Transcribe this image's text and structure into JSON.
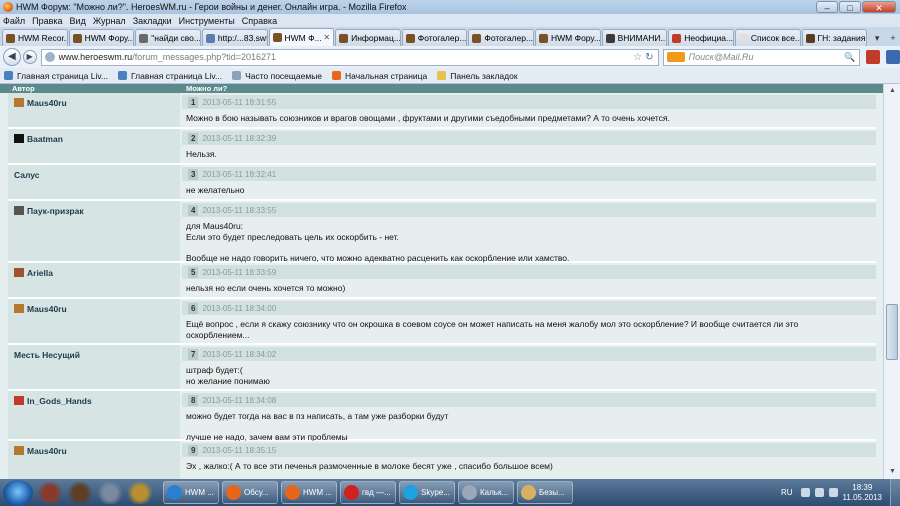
{
  "window": {
    "title": "HWM Форум: \"Можно ли?\". HeroesWM.ru - Герои войны и денег. Онлайн игра. - Mozilla Firefox",
    "minimize": "–",
    "maximize": "□",
    "close": "✕"
  },
  "menu": [
    "Файл",
    "Правка",
    "Вид",
    "Журнал",
    "Закладки",
    "Инструменты",
    "Справка"
  ],
  "tabs": [
    {
      "label": "HWM Recor...",
      "color": "#7a5226"
    },
    {
      "label": "HWM Фору...",
      "color": "#7a5226"
    },
    {
      "label": "\"найди сво...",
      "color": "#6a6a6a"
    },
    {
      "label": "http:/...83.swf",
      "color": "#5b7fb0"
    },
    {
      "label": "HWM Ф...",
      "color": "#7a5226",
      "active": true,
      "close": "✕"
    },
    {
      "label": "Информац...",
      "color": "#7a5226"
    },
    {
      "label": "Фотогалер...",
      "color": "#7a5226"
    },
    {
      "label": "Фотогалер...",
      "color": "#7a5226"
    },
    {
      "label": "HWM Фору...",
      "color": "#7a5226"
    },
    {
      "label": "ВНИМАНИ...",
      "color": "#3a3a3a"
    },
    {
      "label": "Неофициа...",
      "color": "#c0392b"
    },
    {
      "label": "Список все...",
      "color": "#e0e0e0"
    },
    {
      "label": "ГН: задания...",
      "color": "#5a3c20"
    }
  ],
  "tab_controls": {
    "list": "▾",
    "new": "+"
  },
  "nav": {
    "back": "◀",
    "forward": "▶",
    "url_host": "www.heroeswm.ru",
    "url_path": "/forum_messages.php?tid=2016271",
    "star": "☆",
    "reload": "↻",
    "search_placeholder": "Поиск@Mail.Ru",
    "search_go": "🔍"
  },
  "bookmarks": [
    {
      "label": "Главная страница Liv...",
      "color": "#4a7fc0"
    },
    {
      "label": "Главная страница Liv...",
      "color": "#4a7fc0"
    },
    {
      "label": "Часто посещаемые",
      "color": "#8aa0bb"
    },
    {
      "label": "Начальная страница",
      "color": "#e8661b"
    },
    {
      "label": "Панель закладок",
      "color": "#e8c14a"
    }
  ],
  "forum": {
    "col_author": "Автор",
    "col_message": "Можно ли?",
    "posts": [
      {
        "num": "1",
        "author": "Maus40ru",
        "icon_color": "#b5782d",
        "date": "2013-05-11 18:31:55",
        "text": "Можно в бою называть союзников и врагов овощами , фруктами и другими съедобными предметами? А то очень хочется."
      },
      {
        "num": "2",
        "author": "Baatman",
        "icon_color": "#111111",
        "date": "2013-05-11 18:32:39",
        "text": "Нельзя."
      },
      {
        "num": "3",
        "author": "Салус",
        "icon_color": "",
        "date": "2013-05-11 18:32:41",
        "text": "не желательно"
      },
      {
        "num": "4",
        "author": "Паук-призрак",
        "icon_color": "#555555",
        "date": "2013-05-11 18:33:55",
        "text": "для Maus40ru:\nЕсли это будет преследовать цель их оскорбить - нет.\n\nВообще не надо говорить ничего, что можно адекватно расценить как оскорбление или хамство."
      },
      {
        "num": "5",
        "author": "Ariella",
        "icon_color": "#a0522d",
        "date": "2013-05-11 18:33:59",
        "text": "нельзя но если очень хочется то можно)"
      },
      {
        "num": "6",
        "author": "Maus40ru",
        "icon_color": "#b5782d",
        "date": "2013-05-11 18:34:00",
        "text": "Ещё вопрос , если я скажу союзнику что он окрошка в соевом соусе он может написать на меня жалобу мол это оскорбление? И вообще считается ли это\nоскорблением..."
      },
      {
        "num": "7",
        "author": "Месть Несущий",
        "icon_color": "",
        "date": "2013-05-11 18:34:02",
        "text": "штраф будет:(\nно желание понимаю"
      },
      {
        "num": "8",
        "author": "In_Gods_Hands",
        "icon_color": "#c0392b",
        "date": "2013-05-11 18:34:08",
        "text": "можно будет тогда на вас в пз написать, а там уже разборки будут\n\nлучше не надо, зачем вам эти проблемы"
      },
      {
        "num": "9",
        "author": "Maus40ru",
        "icon_color": "#b5782d",
        "date": "2013-05-11 18:35:15",
        "text": "Эх , жалко:( А то все эти печенья размоченные в молоке бесят уже , спасибо большое всем)"
      }
    ]
  },
  "scrollbar": {
    "up": "▲",
    "down": "▼"
  },
  "taskbar": {
    "pinned": [
      {
        "name": "pinned-app-1",
        "color": "#8a3a2a"
      },
      {
        "name": "pinned-app-2",
        "color": "#5a4020"
      },
      {
        "name": "pinned-app-3",
        "color": "#7a8aa0"
      },
      {
        "name": "pinned-app-4",
        "color": "#b89030"
      }
    ],
    "items": [
      {
        "label": "HWM ...",
        "color": "#2a7fd0"
      },
      {
        "label": "Обсу...",
        "color": "#e8661b"
      },
      {
        "label": "HWM ...",
        "color": "#e8661b"
      },
      {
        "label": "гвд —...",
        "color": "#d02020"
      },
      {
        "label": "Skype...",
        "color": "#1fa0e0"
      },
      {
        "label": "Кальк...",
        "color": "#9aa8b8"
      },
      {
        "label": "Безы...",
        "color": "#d8b060"
      }
    ],
    "lang": "RU",
    "time": "18:39",
    "date": "11.05.2013"
  }
}
